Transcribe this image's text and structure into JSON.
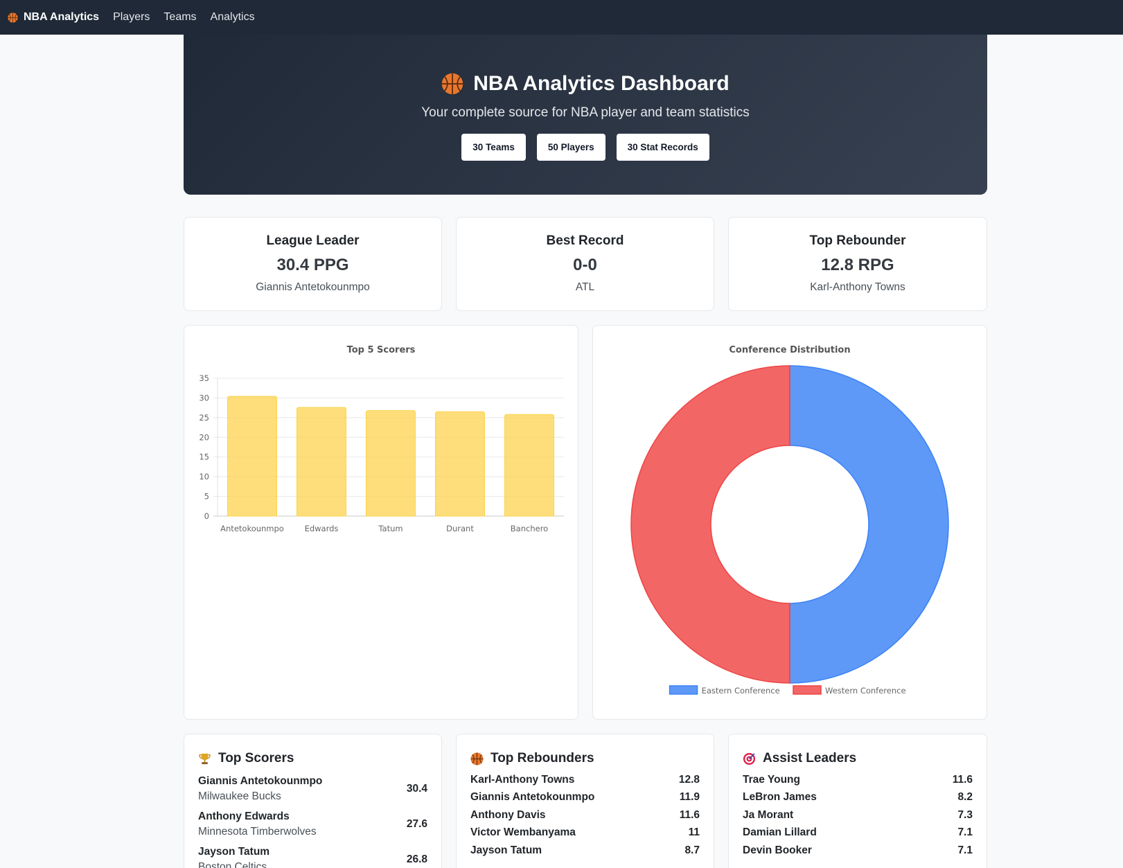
{
  "nav": {
    "brand": "NBA Analytics",
    "links": [
      "Players",
      "Teams",
      "Analytics"
    ]
  },
  "hero": {
    "title": "NBA Analytics Dashboard",
    "subtitle": "Your complete source for NBA player and team statistics",
    "badges": [
      "30 Teams",
      "50 Players",
      "30 Stat Records"
    ]
  },
  "stats": [
    {
      "title": "League Leader",
      "value": "30.4 PPG",
      "sub": "Giannis Antetokounmpo"
    },
    {
      "title": "Best Record",
      "value": "0-0",
      "sub": "ATL"
    },
    {
      "title": "Top Rebounder",
      "value": "12.8 RPG",
      "sub": "Karl-Anthony Towns"
    }
  ],
  "colors": {
    "bar": "#fcd34d",
    "east": "#3b82f6",
    "west": "#ef4444",
    "nav": "#1f2937"
  },
  "chart_data": [
    {
      "type": "bar",
      "title": "Top 5 Scorers",
      "categories": [
        "Antetokounmpo",
        "Edwards",
        "Tatum",
        "Durant",
        "Banchero"
      ],
      "values": [
        30.4,
        27.6,
        26.8,
        26.5,
        25.8
      ],
      "ylim": [
        0,
        35
      ],
      "yticks": [
        0,
        5,
        10,
        15,
        20,
        25,
        30,
        35
      ],
      "grid": true
    },
    {
      "type": "pie",
      "title": "Conference Distribution",
      "labels": [
        "Eastern Conference",
        "Western Conference"
      ],
      "values": [
        15,
        15
      ],
      "legend": "bottom"
    }
  ],
  "lists": {
    "scorers": {
      "title": "Top Scorers",
      "icon": "trophy-icon",
      "items": [
        {
          "name": "Giannis Antetokounmpo",
          "team": "Milwaukee Bucks",
          "value": "30.4"
        },
        {
          "name": "Anthony Edwards",
          "team": "Minnesota Timberwolves",
          "value": "27.6"
        },
        {
          "name": "Jayson Tatum",
          "team": "Boston Celtics",
          "value": "26.8"
        }
      ]
    },
    "rebounders": {
      "title": "Top Rebounders",
      "icon": "basketball-icon",
      "items": [
        {
          "name": "Karl-Anthony Towns",
          "value": "12.8"
        },
        {
          "name": "Giannis Antetokounmpo",
          "value": "11.9"
        },
        {
          "name": "Anthony Davis",
          "value": "11.6"
        },
        {
          "name": "Victor Wembanyama",
          "value": "11"
        },
        {
          "name": "Jayson Tatum",
          "value": "8.7"
        }
      ]
    },
    "assists": {
      "title": "Assist Leaders",
      "icon": "target-icon",
      "items": [
        {
          "name": "Trae Young",
          "value": "11.6"
        },
        {
          "name": "LeBron James",
          "value": "8.2"
        },
        {
          "name": "Ja Morant",
          "value": "7.3"
        },
        {
          "name": "Damian Lillard",
          "value": "7.1"
        },
        {
          "name": "Devin Booker",
          "value": "7.1"
        }
      ]
    }
  }
}
